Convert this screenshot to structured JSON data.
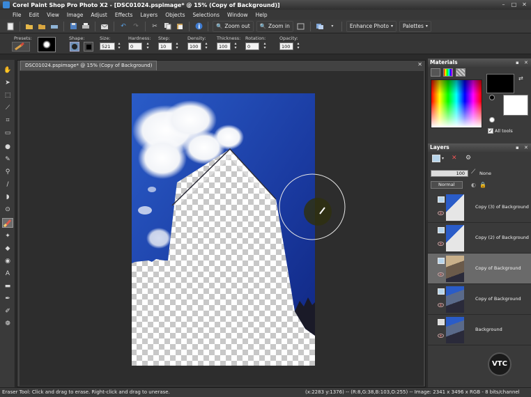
{
  "window": {
    "title": "Corel Paint Shop Pro Photo X2 - [DSC01024.pspimage* @  15% (Copy of Background)]",
    "controls": [
      "minimize-icon",
      "maximize-icon",
      "close-icon"
    ]
  },
  "menu": [
    "File",
    "Edit",
    "View",
    "Image",
    "Adjust",
    "Effects",
    "Layers",
    "Objects",
    "Selections",
    "Window",
    "Help"
  ],
  "toolbar": {
    "zoom_out": "Zoom out",
    "zoom_in": "Zoom in",
    "enhance_photo": "Enhance Photo",
    "palettes": "Palettes"
  },
  "tool_options": {
    "presets_label": "Presets:",
    "shape_label": "Shape:",
    "size_label": "Size:",
    "size_value": "521",
    "hardness_label": "Hardness:",
    "hardness_value": "0",
    "step_label": "Step:",
    "step_value": "10",
    "density_label": "Density:",
    "density_value": "100",
    "thickness_label": "Thickness:",
    "thickness_value": "100",
    "rotation_label": "Rotation:",
    "rotation_value": "0",
    "opacity_label": "Opacity:",
    "opacity_value": "100"
  },
  "document": {
    "tab_title": "DSC01024.pspimage* @  15% (Copy of Background)"
  },
  "materials": {
    "title": "Materials",
    "all_tools_label": "All tools",
    "foreground_color": "#000000",
    "background_color": "#ffffff"
  },
  "layers": {
    "title": "Layers",
    "opacity_value": "100",
    "none_label": "None",
    "blend_mode": "Normal",
    "items": [
      {
        "name": "Copy (3) of Background"
      },
      {
        "name": "Copy (2) of Background"
      },
      {
        "name": "Copy of Background"
      },
      {
        "name": "Copy of Background"
      },
      {
        "name": "Background"
      }
    ]
  },
  "status": {
    "hint": "Eraser Tool: Click and drag to erase. Right-click and drag to unerase.",
    "info": "(x:2283 y:1376) -- (R:8,G:38,B:103,O:255) -- Image:  2341 x 3496 x RGB - 8 bits/channel"
  },
  "watermark": "VTC",
  "colors": {
    "sky_blue": "#1c3fa8",
    "selected_layer": "#6a6a6a"
  }
}
